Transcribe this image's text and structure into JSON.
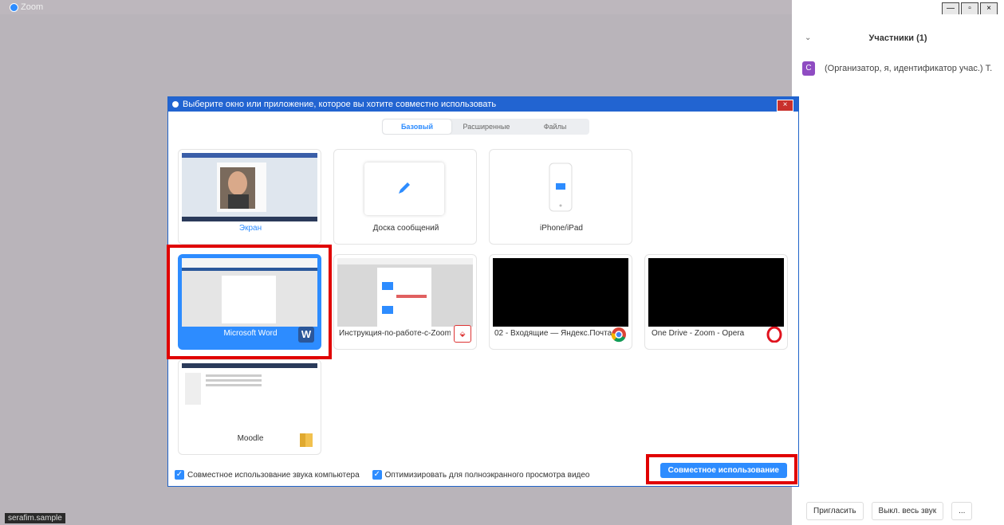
{
  "window": {
    "title": "Zoom",
    "controls": [
      "—",
      "▫",
      "×"
    ],
    "username": "serafim.sample"
  },
  "participants": {
    "header": "Участники (1)",
    "items": [
      {
        "initial": "C",
        "text": "(Организатор, я, идентификатор учас.) Т."
      }
    ],
    "buttons": {
      "invite": "Пригласить",
      "mute_all": "Выкл. весь звук",
      "more": "..."
    }
  },
  "dialog": {
    "title": "Выберите окно или приложение, которое вы хотите совместно использовать",
    "close": "×",
    "tabs": [
      "Базовый",
      "Расширенные",
      "Файлы"
    ],
    "tiles": [
      {
        "label": "Экран"
      },
      {
        "label": "Доска сообщений"
      },
      {
        "label": "iPhone/iPad"
      },
      {
        "label": "Microsoft Word",
        "selected": true
      },
      {
        "label": "Инструкция-по-работе-с-Zoom..."
      },
      {
        "label": "02 - Входящие — Яндекс.Почта"
      },
      {
        "label": "One Drive - Zoom - Opera"
      },
      {
        "label": "Moodle"
      }
    ],
    "checks": {
      "sound": "Совместное использование звука компьютера",
      "video": "Оптимизировать для полноэкранного просмотра видео"
    },
    "share_button": "Совместное использование"
  },
  "colors": {
    "accent": "#2d8cff",
    "highlight": "#e00000",
    "titlebar": "#2264d1"
  }
}
